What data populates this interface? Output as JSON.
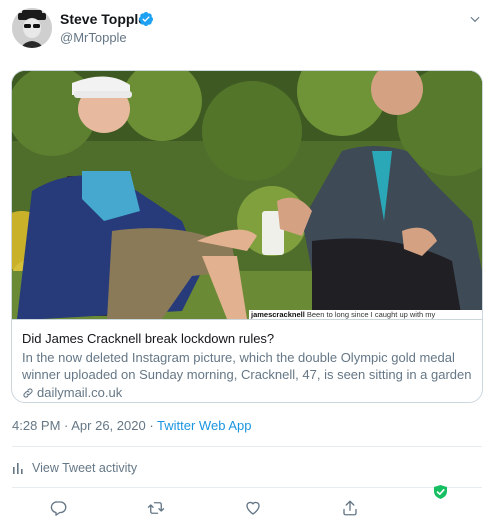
{
  "tweet": {
    "author_name": "Steve Topple",
    "author_handle": "@MrTopple",
    "verified": true,
    "timestamp": "4:28 PM · Apr 26, 2020",
    "source_separator": " · ",
    "source": "Twitter Web App"
  },
  "card": {
    "image_caption_user": "jamescracknell",
    "image_caption_text": " Been to long since I caught up with my",
    "title": "Did James Cracknell break lockdown rules?",
    "description": "In the now deleted Instagram picture, which the double Olympic gold medal winner uploaded on Sunday morning, Cracknell, 47, is seen sitting in a garden ne…",
    "domain": "dailymail.co.uk"
  },
  "activity": {
    "label": "View Tweet activity"
  },
  "actions": [
    "reply",
    "retweet",
    "like",
    "share"
  ],
  "colors": {
    "verified_blue": "#1da1f2",
    "link_blue": "#1b95e0",
    "secondary_gray": "#657786",
    "shield_green": "#17bf63"
  }
}
